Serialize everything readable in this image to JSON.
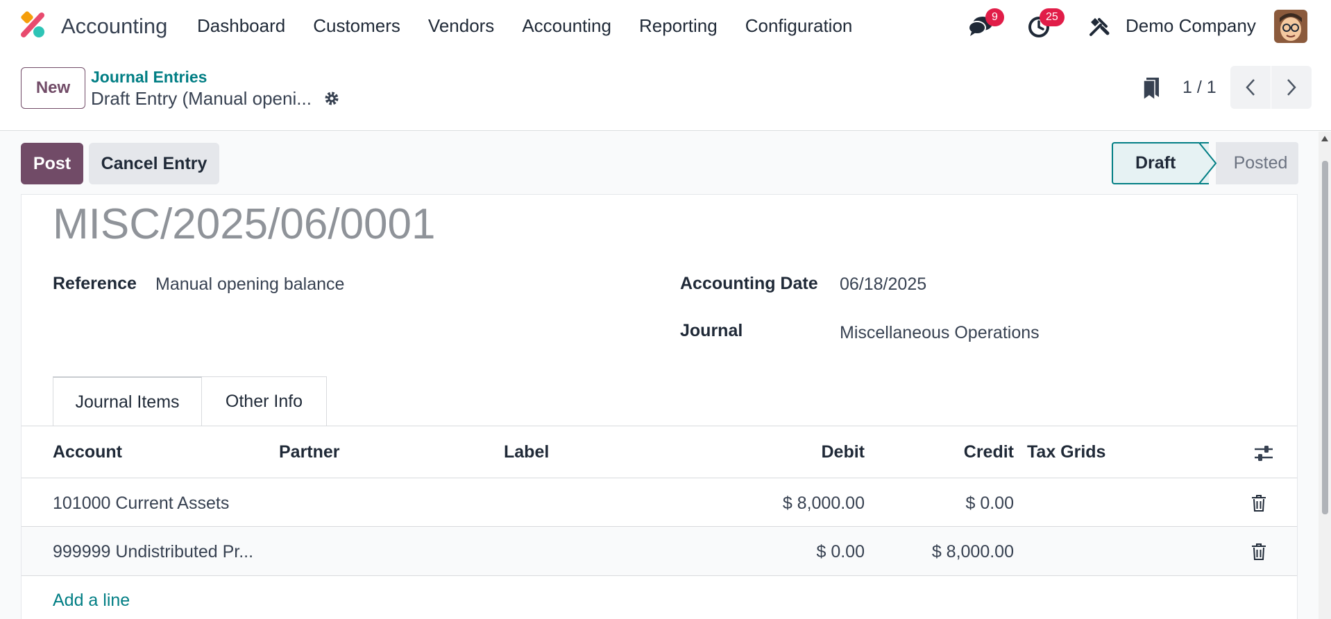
{
  "navbar": {
    "app_name": "Accounting",
    "menu": [
      "Dashboard",
      "Customers",
      "Vendors",
      "Accounting",
      "Reporting",
      "Configuration"
    ],
    "messages_badge": "9",
    "activities_badge": "25",
    "company": "Demo Company"
  },
  "control_panel": {
    "new_label": "New",
    "breadcrumb_parent": "Journal Entries",
    "breadcrumb_current": "Draft Entry (Manual openi...",
    "pager": "1 / 1"
  },
  "actions": {
    "post_label": "Post",
    "cancel_label": "Cancel Entry"
  },
  "status": {
    "stages": [
      "Draft",
      "Posted"
    ],
    "current": "Draft"
  },
  "record": {
    "name": "MISC/2025/06/0001",
    "reference_label": "Reference",
    "reference_value": "Manual opening balance",
    "date_label": "Accounting Date",
    "date_value": "06/18/2025",
    "journal_label": "Journal",
    "journal_value": "Miscellaneous Operations"
  },
  "tabs": [
    "Journal Items",
    "Other Info"
  ],
  "table": {
    "columns": [
      "Account",
      "Partner",
      "Label",
      "Debit",
      "Credit",
      "Tax Grids"
    ],
    "rows": [
      {
        "account": "101000 Current Assets",
        "partner": "",
        "label": "",
        "debit": "$ 8,000.00",
        "credit": "$ 0.00",
        "tax_grids": ""
      },
      {
        "account": "999999 Undistributed Pr...",
        "partner": "",
        "label": "",
        "debit": "$ 0.00",
        "credit": "$ 8,000.00",
        "tax_grids": ""
      }
    ],
    "add_line": "Add a line"
  },
  "colors": {
    "brand": "#714b67",
    "link": "#017e84",
    "badge": "#e11d48"
  },
  "icons": [
    "app-logo-icon",
    "chat-icon",
    "clock-icon",
    "tools-icon",
    "gear-icon",
    "bookmark-icon",
    "chevron-left-icon",
    "chevron-right-icon",
    "settings-sliders-icon",
    "trash-icon"
  ]
}
